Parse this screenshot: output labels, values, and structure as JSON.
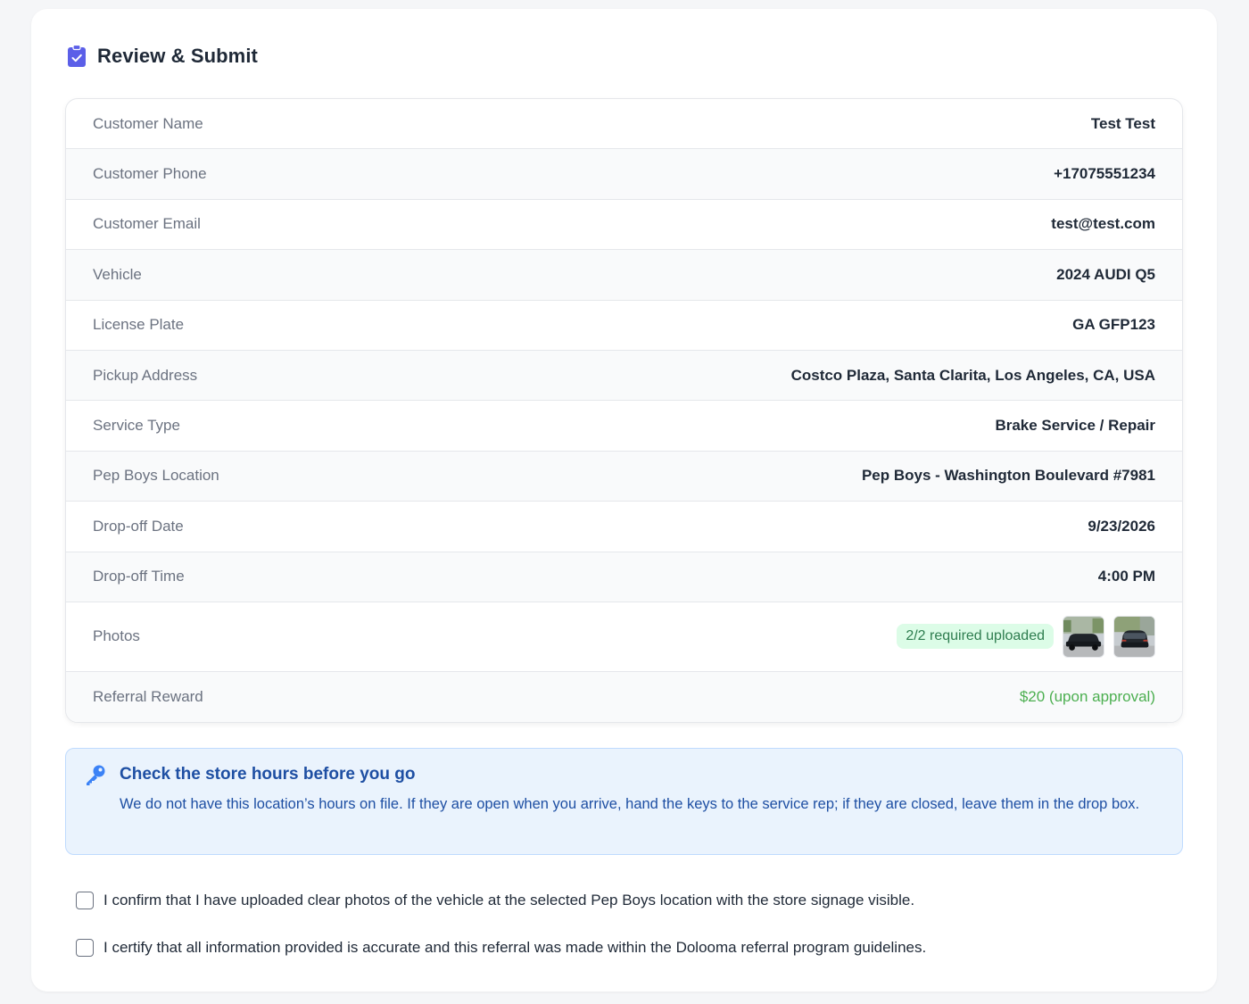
{
  "header": {
    "title": "Review & Submit",
    "icon": "clipboard-check-icon"
  },
  "summary": {
    "customer_name": {
      "label": "Customer Name",
      "value": "Test Test"
    },
    "customer_phone": {
      "label": "Customer Phone",
      "value": "+17075551234"
    },
    "customer_email": {
      "label": "Customer Email",
      "value": "test@test.com"
    },
    "vehicle": {
      "label": "Vehicle",
      "value": "2024 AUDI Q5"
    },
    "license_plate": {
      "label": "License Plate",
      "value": "GA GFP123"
    },
    "pickup_address": {
      "label": "Pickup Address",
      "value": "Costco Plaza, Santa Clarita, Los Angeles, CA, USA"
    },
    "service_type": {
      "label": "Service Type",
      "value": "Brake Service / Repair"
    },
    "location": {
      "label": "Pep Boys Location",
      "value": "Pep Boys - Washington Boulevard #7981"
    },
    "dropoff_date": {
      "label": "Drop-off Date",
      "value": "9/23/2026"
    },
    "dropoff_time": {
      "label": "Drop-off Time",
      "value": "4:00 PM"
    },
    "photos": {
      "label": "Photos",
      "badge": "2/2 required uploaded"
    },
    "referral_reward": {
      "label": "Referral Reward",
      "value": "$20 (upon approval)"
    }
  },
  "notice": {
    "icon": "key-icon",
    "title": "Check the store hours before you go",
    "body": "We do not have this location’s hours on file. If they are open when you arrive, hand the keys to the service rep; if they are closed, leave them in the drop box."
  },
  "confirmations": [
    {
      "label": "I confirm that I have uploaded clear photos of the vehicle at the selected Pep Boys location with the store signage visible.",
      "checked": false
    },
    {
      "label": "I certify that all information provided is accurate and this referral was made within the Dolooma referral program guidelines.",
      "checked": false
    }
  ],
  "colors": {
    "accent": "#6366f1",
    "notice_text": "#1e4fa3",
    "notice_bg": "#eaf3fd",
    "reward_green": "#4caf50",
    "badge_bg": "#dcfce7"
  }
}
